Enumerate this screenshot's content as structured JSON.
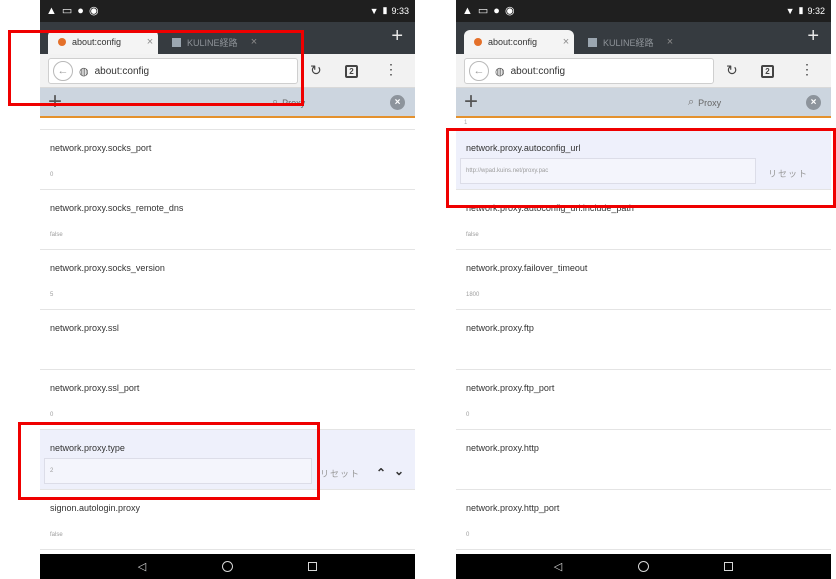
{
  "colors": {
    "highlight": "#ef0000",
    "tab_strip": "#363b40",
    "filter_bar": "#ccd5df",
    "filter_accent": "#e4912d",
    "selected_row": "#eef0fb"
  },
  "left": {
    "status": {
      "icons": [
        "warning-icon",
        "cast-icon",
        "info-icon",
        "tethering-icon"
      ],
      "time": "9:33"
    },
    "tabs": [
      {
        "label": "about:config",
        "close": "×",
        "icon": "firefox-icon"
      },
      {
        "label": "KULINE経路",
        "close": "×",
        "icon": "site-icon"
      }
    ],
    "new_tab": "+",
    "url": "about:config",
    "filter": {
      "add": "+",
      "query": "Proxy",
      "clear": "×"
    },
    "stub": "",
    "prefs": [
      {
        "name": "network.proxy.socks_port",
        "value": "0"
      },
      {
        "name": "network.proxy.socks_remote_dns",
        "value": "false"
      },
      {
        "name": "network.proxy.socks_version",
        "value": "5"
      },
      {
        "name": "network.proxy.ssl",
        "value": ""
      },
      {
        "name": "network.proxy.ssl_port",
        "value": "0"
      },
      {
        "name": "network.proxy.type",
        "value": "2",
        "reset": "リセット",
        "up": "⌃",
        "down": "⌄"
      },
      {
        "name": "signon.autologin.proxy",
        "value": "false"
      }
    ]
  },
  "right": {
    "status": {
      "icons": [
        "warning-icon",
        "cast-icon",
        "info-icon",
        "tethering-icon"
      ],
      "time": "9:32"
    },
    "tabs": [
      {
        "label": "about:config",
        "close": "×",
        "icon": "firefox-icon"
      },
      {
        "label": "KULINE経路",
        "close": "×",
        "icon": "site-icon"
      }
    ],
    "new_tab": "+",
    "url": "about:config",
    "filter": {
      "add": "+",
      "query": "Proxy",
      "clear": "×"
    },
    "stub": "1",
    "prefs": [
      {
        "name": "network.proxy.autoconfig_url",
        "value": "http://wpad.kuins.net/proxy.pac",
        "reset": "リセット"
      },
      {
        "name": "network.proxy.autoconfig_url.include_path",
        "value": "false"
      },
      {
        "name": "network.proxy.failover_timeout",
        "value": "1800"
      },
      {
        "name": "network.proxy.ftp",
        "value": ""
      },
      {
        "name": "network.proxy.ftp_port",
        "value": "0"
      },
      {
        "name": "network.proxy.http",
        "value": ""
      },
      {
        "name": "network.proxy.http_port",
        "value": "0"
      }
    ]
  }
}
